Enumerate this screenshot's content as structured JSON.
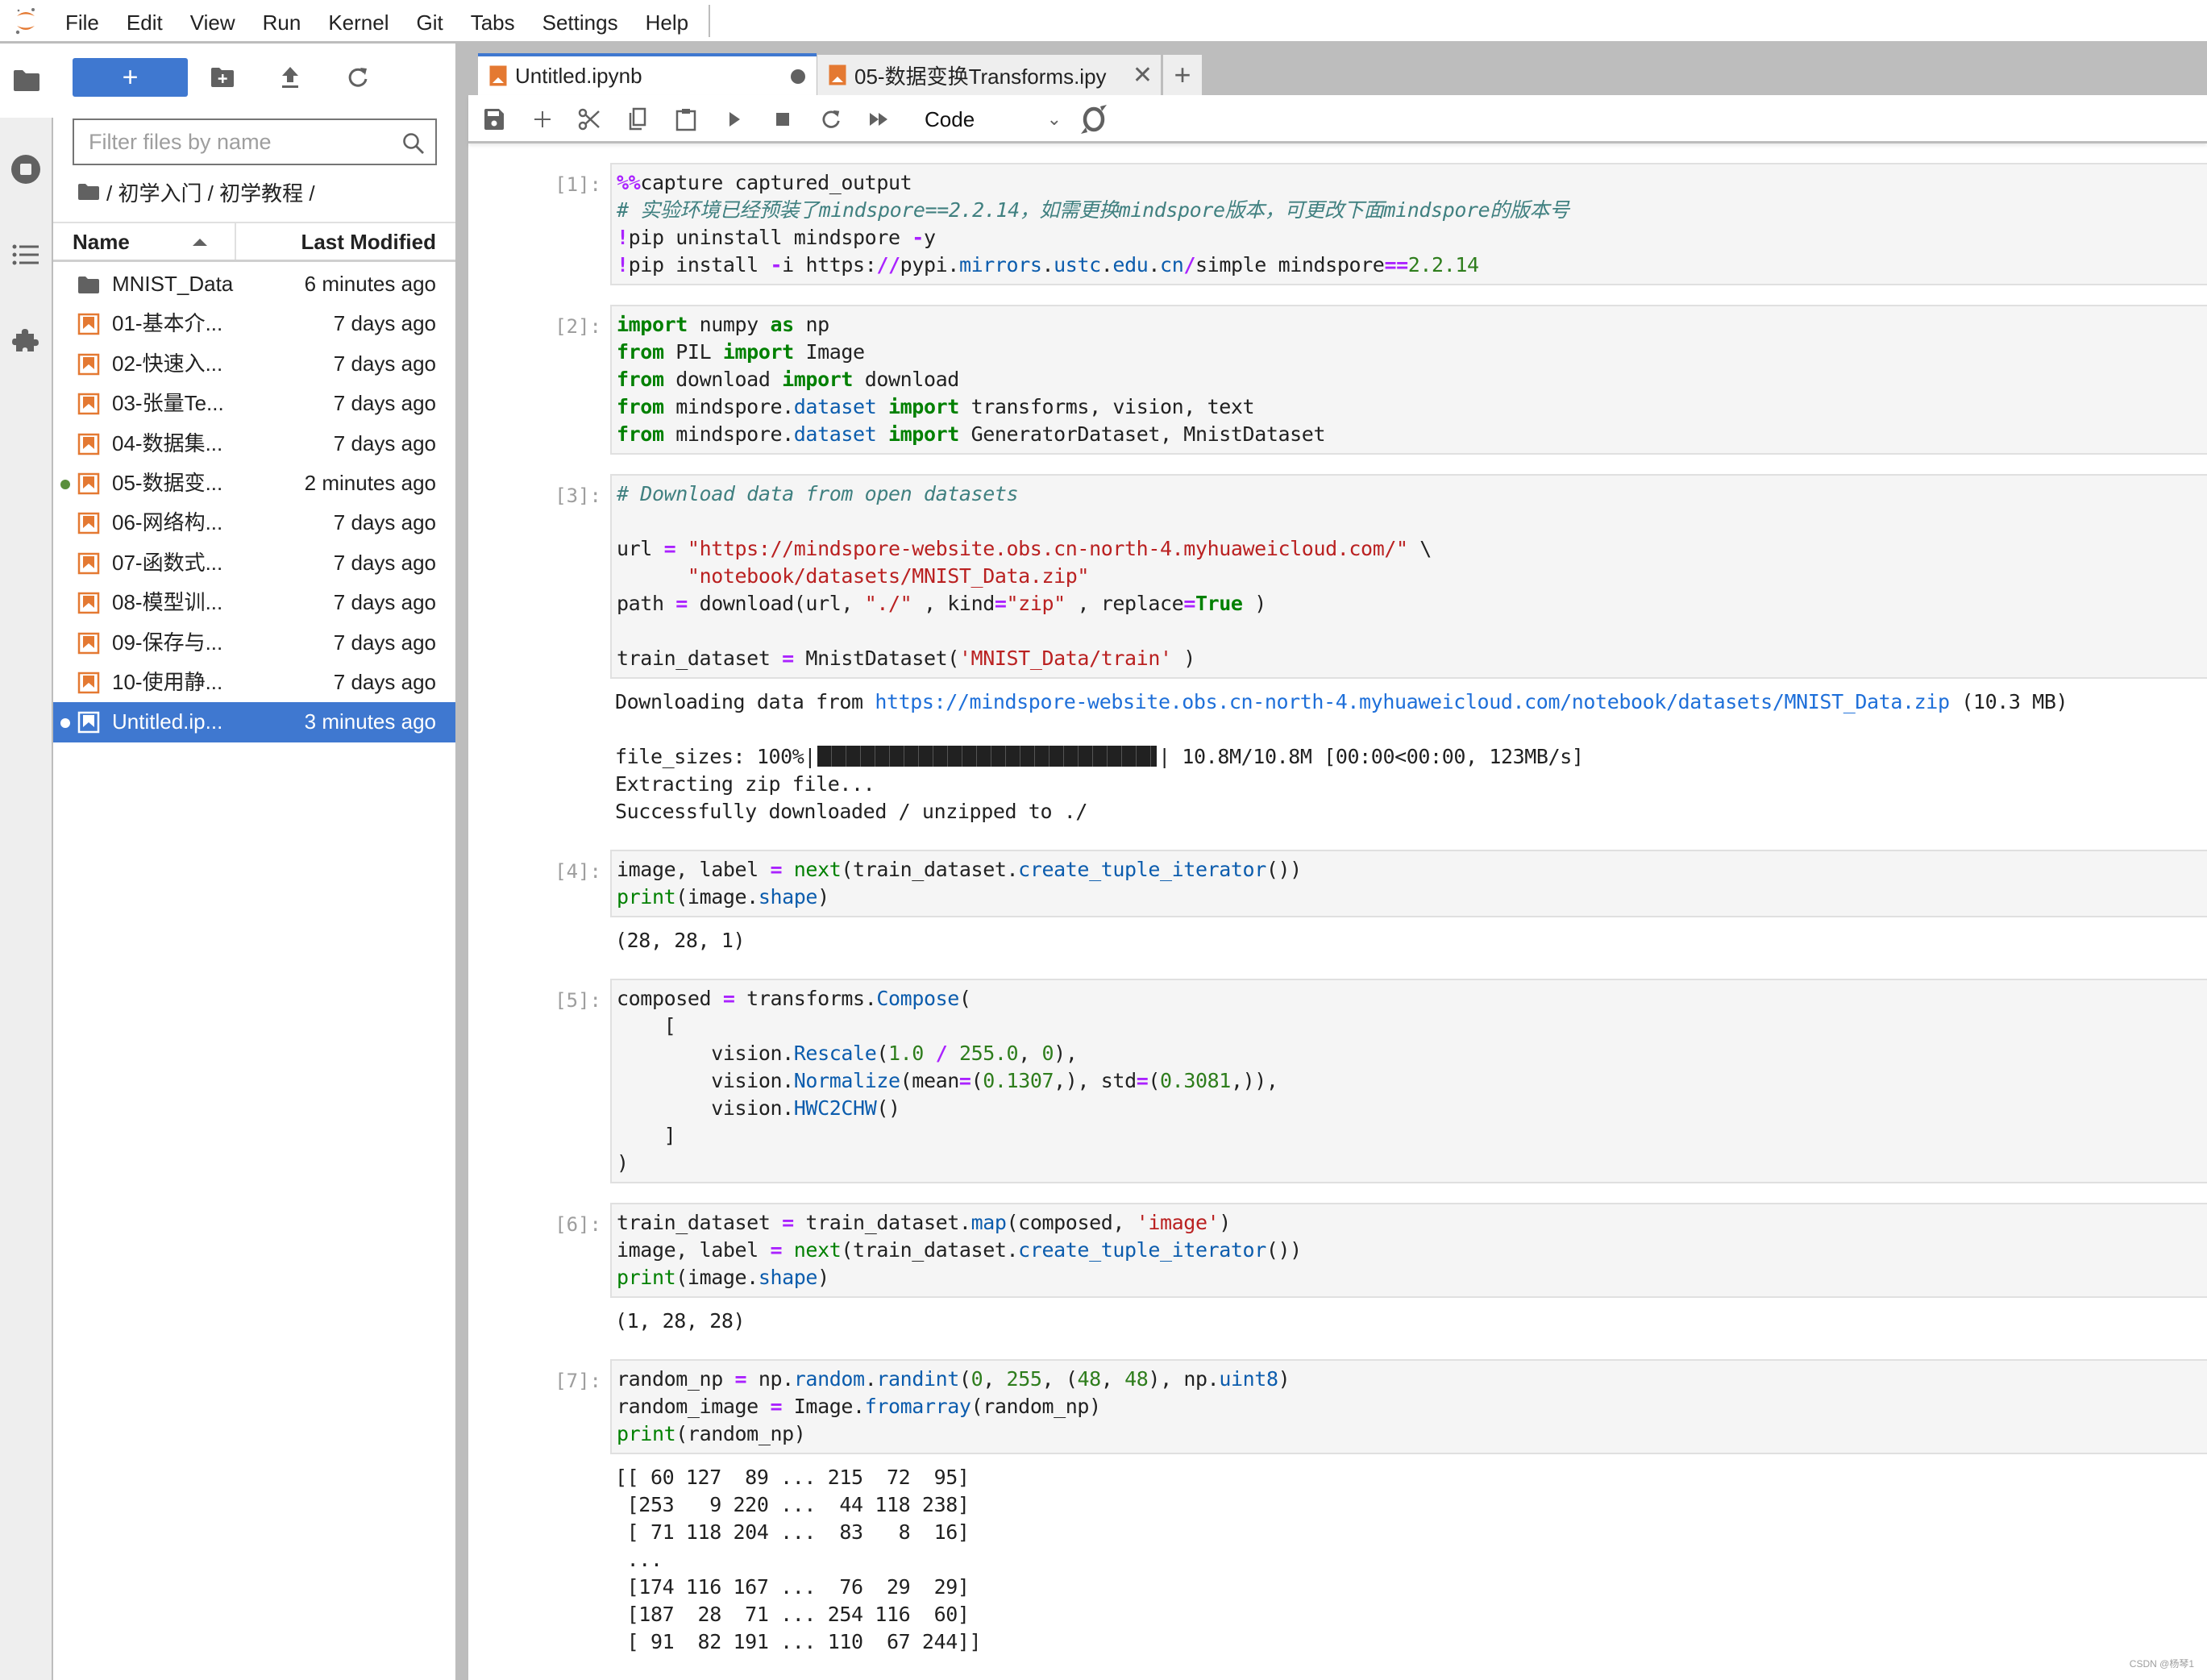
{
  "menubar": {
    "items": [
      "File",
      "Edit",
      "View",
      "Run",
      "Kernel",
      "Git",
      "Tabs",
      "Settings",
      "Help"
    ]
  },
  "activity_bar": {
    "items": [
      "file-browser",
      "running-kernels",
      "table-of-contents",
      "extension-manager"
    ]
  },
  "sidebar": {
    "new_button_label": "+",
    "filter_placeholder": "Filter files by name",
    "breadcrumb": "/ 初学入门 / 初学教程 /",
    "columns": {
      "name": "Name",
      "modified": "Last Modified"
    },
    "files": [
      {
        "name": "MNIST_Data",
        "modified": "6 minutes ago",
        "type": "folder",
        "running": false,
        "selected": false
      },
      {
        "name": "01-基本介...",
        "modified": "7 days ago",
        "type": "notebook",
        "running": false,
        "selected": false
      },
      {
        "name": "02-快速入...",
        "modified": "7 days ago",
        "type": "notebook",
        "running": false,
        "selected": false
      },
      {
        "name": "03-张量Te...",
        "modified": "7 days ago",
        "type": "notebook",
        "running": false,
        "selected": false
      },
      {
        "name": "04-数据集...",
        "modified": "7 days ago",
        "type": "notebook",
        "running": false,
        "selected": false
      },
      {
        "name": "05-数据变...",
        "modified": "2 minutes ago",
        "type": "notebook",
        "running": true,
        "selected": false
      },
      {
        "name": "06-网络构...",
        "modified": "7 days ago",
        "type": "notebook",
        "running": false,
        "selected": false
      },
      {
        "name": "07-函数式...",
        "modified": "7 days ago",
        "type": "notebook",
        "running": false,
        "selected": false
      },
      {
        "name": "08-模型训...",
        "modified": "7 days ago",
        "type": "notebook",
        "running": false,
        "selected": false
      },
      {
        "name": "09-保存与...",
        "modified": "7 days ago",
        "type": "notebook",
        "running": false,
        "selected": false
      },
      {
        "name": "10-使用静...",
        "modified": "7 days ago",
        "type": "notebook",
        "running": false,
        "selected": false
      },
      {
        "name": "Untitled.ip...",
        "modified": "3 minutes ago",
        "type": "notebook",
        "running": true,
        "selected": true
      }
    ]
  },
  "tabs": [
    {
      "label": "Untitled.ipynb",
      "active": true,
      "modified": true
    },
    {
      "label": "05-数据变换Transforms.ipy",
      "active": false,
      "modified": false
    }
  ],
  "toolbar": {
    "buttons": [
      "save",
      "insert-cell",
      "cut",
      "copy",
      "paste",
      "run",
      "interrupt",
      "restart",
      "restart-run-all"
    ],
    "cell_type": "Code"
  },
  "colors": {
    "accent": "#3f78d0",
    "notebook_icon": "#e47932",
    "running_dot": "#5a8f3c"
  },
  "cells": [
    {
      "prompt": "[1]:",
      "code": [
        [
          [
            "op",
            "%%"
          ],
          [
            "",
            "capture captured_output"
          ]
        ],
        [
          [
            "cm",
            "# 实验环境已经预装了mindspore==2.2.14，如需更换mindspore版本，可更改下面mindspore的版本号"
          ]
        ],
        [
          [
            "op",
            "!"
          ],
          [
            "",
            "pip uninstall mindspore "
          ],
          [
            "op",
            "-"
          ],
          [
            "",
            "y"
          ]
        ],
        [
          [
            "op",
            "!"
          ],
          [
            "",
            "pip install "
          ],
          [
            "op",
            "-"
          ],
          [
            "",
            "i https:"
          ],
          [
            "op",
            "//"
          ],
          [
            "",
            "pypi."
          ],
          [
            "attr",
            "mirrors"
          ],
          [
            "",
            "."
          ],
          [
            "attr",
            "ustc"
          ],
          [
            "",
            "."
          ],
          [
            "attr",
            "edu"
          ],
          [
            "",
            "."
          ],
          [
            "attr",
            "cn"
          ],
          [
            "op",
            "/"
          ],
          [
            "",
            "simple mindspore"
          ],
          [
            "op",
            "=="
          ],
          [
            "num",
            "2.2.14"
          ]
        ]
      ],
      "output": []
    },
    {
      "prompt": "[2]:",
      "code": [
        [
          [
            "kw",
            "import"
          ],
          [
            "",
            " numpy "
          ],
          [
            "kw",
            "as"
          ],
          [
            "",
            "",
            " np"
          ]
        ],
        [
          [
            "kw",
            "from"
          ],
          [
            "",
            "",
            " PIL "
          ],
          [
            "kw",
            "import"
          ],
          [
            "",
            "",
            " Image"
          ]
        ],
        [
          [
            "kw",
            "from"
          ],
          [
            "",
            "",
            " download "
          ],
          [
            "kw",
            "import"
          ],
          [
            "",
            "",
            " download"
          ]
        ],
        [
          [
            "kw",
            "from"
          ],
          [
            "",
            "",
            " mindspore."
          ],
          [
            "attr",
            "dataset"
          ],
          [
            "",
            "",
            " "
          ],
          [
            "kw",
            "import"
          ],
          [
            "",
            "",
            " transforms, vision, text"
          ]
        ],
        [
          [
            "kw",
            "from"
          ],
          [
            "",
            "",
            " mindspore."
          ],
          [
            "attr",
            "dataset"
          ],
          [
            "",
            "",
            " "
          ],
          [
            "kw",
            "import"
          ],
          [
            "",
            "",
            " GeneratorDataset, MnistDataset"
          ]
        ]
      ],
      "output": []
    },
    {
      "prompt": "[3]:",
      "code": [
        [
          [
            "cm",
            "# Download data from open datasets"
          ]
        ],
        [],
        [
          [
            "",
            "url "
          ],
          [
            "op",
            "="
          ],
          [
            "",
            "",
            " "
          ],
          [
            "str",
            "\"https://mindspore-website.obs.cn-north-4.myhuaweicloud.com/\""
          ],
          [
            "",
            "",
            " \\"
          ]
        ],
        [
          [
            "",
            "      "
          ],
          [
            "str",
            "\"notebook/datasets/MNIST_Data.zip\""
          ]
        ],
        [
          [
            "",
            "path "
          ],
          [
            "op",
            "="
          ],
          [
            "",
            "",
            " download(url, "
          ],
          [
            "str",
            "\"./\""
          ],
          [
            "",
            "",
            " , kind"
          ],
          [
            "op",
            "="
          ],
          [
            "str",
            "\"zip\""
          ],
          [
            "",
            "",
            " , replace"
          ],
          [
            "op",
            "="
          ],
          [
            "kw",
            "True"
          ],
          [
            "",
            "",
            " )"
          ]
        ],
        [],
        [
          [
            "",
            "train_dataset "
          ],
          [
            "op",
            "="
          ],
          [
            "",
            "",
            " MnistDataset("
          ],
          [
            "str",
            "'MNIST_Data/train'"
          ],
          [
            "",
            "",
            " )"
          ]
        ]
      ],
      "output": [
        [
          [
            "",
            "Downloading data from "
          ],
          [
            "link",
            "https://mindspore-website.obs.cn-north-4.myhuaweicloud.com/notebook/datasets/MNIST_Data.zip"
          ],
          [
            "",
            "",
            " (10.3 MB)"
          ]
        ],
        [],
        [
          [
            "",
            "file_sizes: 100%|"
          ],
          [
            "pbar",
            ""
          ],
          [
            "",
            "| 10.8M/10.8M [00:00<00:00, 123MB/s]"
          ]
        ],
        [
          [
            "",
            "Extracting zip file..."
          ]
        ],
        [
          [
            "",
            "Successfully downloaded / unzipped to ./"
          ]
        ]
      ],
      "progress_percent": 100
    },
    {
      "prompt": "[4]:",
      "code": [
        [
          [
            "",
            "image, label "
          ],
          [
            "op",
            "="
          ],
          [
            "",
            "",
            " "
          ],
          [
            "bi",
            "next"
          ],
          [
            "",
            "(train_dataset."
          ],
          [
            "attr",
            "create_tuple_iterator"
          ],
          [
            "",
            "())"
          ]
        ],
        [
          [
            "bi",
            "print"
          ],
          [
            "",
            "(image."
          ],
          [
            "attr",
            "shape"
          ],
          [
            "",
            ")"
          ]
        ]
      ],
      "output": [
        [
          [
            "",
            "(28, 28, 1)"
          ]
        ]
      ]
    },
    {
      "prompt": "[5]:",
      "code": [
        [
          [
            "",
            "composed "
          ],
          [
            "op",
            "="
          ],
          [
            "",
            "",
            " transforms."
          ],
          [
            "attr",
            "Compose"
          ],
          [
            "",
            "("
          ]
        ],
        [
          [
            "",
            "    ["
          ]
        ],
        [
          [
            "",
            "        vision."
          ],
          [
            "attr",
            "Rescale"
          ],
          [
            "",
            "("
          ],
          [
            "num",
            "1.0"
          ],
          [
            "",
            "",
            " "
          ],
          [
            "op",
            "/"
          ],
          [
            "",
            "",
            " "
          ],
          [
            "num",
            "255.0"
          ],
          [
            "",
            ", "
          ],
          [
            "num",
            "0"
          ],
          [
            "",
            "),"
          ]
        ],
        [
          [
            "",
            "        vision."
          ],
          [
            "attr",
            "Normalize"
          ],
          [
            "",
            "(mean"
          ],
          [
            "op",
            "="
          ],
          [
            "",
            "("
          ],
          [
            "num",
            "0.1307"
          ],
          [
            "",
            ",), std"
          ],
          [
            "op",
            "="
          ],
          [
            "",
            "("
          ],
          [
            "num",
            "0.3081"
          ],
          [
            "",
            ",)),"
          ]
        ],
        [
          [
            "",
            "        vision."
          ],
          [
            "attr",
            "HWC2CHW"
          ],
          [
            "",
            "()"
          ]
        ],
        [
          [
            "",
            "    ]"
          ]
        ],
        [
          [
            "",
            ")"
          ]
        ]
      ],
      "output": []
    },
    {
      "prompt": "[6]:",
      "code": [
        [
          [
            "",
            "train_dataset "
          ],
          [
            "op",
            "="
          ],
          [
            "",
            "",
            " train_dataset."
          ],
          [
            "attr",
            "map"
          ],
          [
            "",
            "(composed, "
          ],
          [
            "str",
            "'image'"
          ],
          [
            "",
            ")"
          ]
        ],
        [
          [
            "",
            "image, label "
          ],
          [
            "op",
            "="
          ],
          [
            "",
            "",
            " "
          ],
          [
            "bi",
            "next"
          ],
          [
            "",
            "(train_dataset."
          ],
          [
            "attr",
            "create_tuple_iterator"
          ],
          [
            "",
            "())"
          ]
        ],
        [
          [
            "bi",
            "print"
          ],
          [
            "",
            "(image."
          ],
          [
            "attr",
            "shape"
          ],
          [
            "",
            ")"
          ]
        ]
      ],
      "output": [
        [
          [
            "",
            "(1, 28, 28)"
          ]
        ]
      ]
    },
    {
      "prompt": "[7]:",
      "code": [
        [
          [
            "",
            "random_np "
          ],
          [
            "op",
            "="
          ],
          [
            "",
            "",
            " np."
          ],
          [
            "attr",
            "random"
          ],
          [
            "",
            "."
          ],
          [
            "attr",
            "randint"
          ],
          [
            "",
            "("
          ],
          [
            "num",
            "0"
          ],
          [
            "",
            ", "
          ],
          [
            "num",
            "255"
          ],
          [
            "",
            ", ("
          ],
          [
            "num",
            "48"
          ],
          [
            "",
            ", "
          ],
          [
            "num",
            "48"
          ],
          [
            "",
            "), np."
          ],
          [
            "attr",
            "uint8"
          ],
          [
            "",
            ")"
          ]
        ],
        [
          [
            "",
            "random_image "
          ],
          [
            "op",
            "="
          ],
          [
            "",
            "",
            " Image."
          ],
          [
            "attr",
            "fromarray"
          ],
          [
            "",
            "(random_np)"
          ]
        ],
        [
          [
            "bi",
            "print"
          ],
          [
            "",
            "(random_np)"
          ]
        ]
      ],
      "output": [
        [
          [
            "",
            "[[ 60 127  89 ... 215  72  95]"
          ]
        ],
        [
          [
            "",
            "",
            " [253   9 220 ...  44 118 238]"
          ]
        ],
        [
          [
            "",
            "",
            " [ 71 118 204 ...  83   8  16]"
          ]
        ],
        [
          [
            "",
            "",
            " ..."
          ]
        ],
        [
          [
            "",
            "",
            " [174 116 167 ...  76  29  29]"
          ]
        ],
        [
          [
            "",
            "",
            " [187  28  71 ... 254 116  60]"
          ]
        ],
        [
          [
            "",
            "",
            " [ 91  82 191 ... 110  67 244]]"
          ]
        ]
      ]
    }
  ],
  "watermark": "CSDN @杨琴1"
}
